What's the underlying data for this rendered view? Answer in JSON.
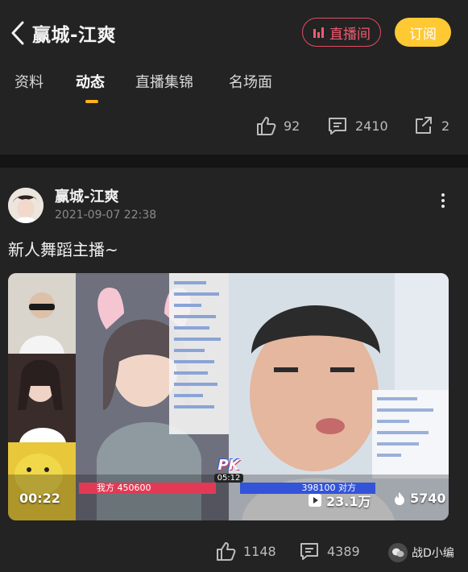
{
  "header": {
    "title": "赢城-江爽",
    "live_button": "直播间",
    "subscribe_button": "订阅"
  },
  "tabs": [
    {
      "label": "资料",
      "active": false
    },
    {
      "label": "动态",
      "active": true
    },
    {
      "label": "直播集锦",
      "active": false
    },
    {
      "label": "名场面",
      "active": false
    }
  ],
  "stats": {
    "likes": "92",
    "comments": "2410",
    "shares": "2"
  },
  "post": {
    "author": "赢城-江爽",
    "timestamp": "2021-09-07 22:38",
    "text": "新人舞蹈主播~",
    "video": {
      "duration": "00:22",
      "views": "23.1万",
      "heat": "5740",
      "pk_logo": "PK",
      "pk_timer": "05:12",
      "pk_left_label": "我方 450600",
      "pk_right_label": "398100 对方"
    },
    "likes": "1148",
    "comments": "4389"
  },
  "watermark": "战D小编",
  "colors": {
    "background": "#232323",
    "accent_live": "#e24b63",
    "accent_subscribe": "#ffc933",
    "tab_underline": "#ffb21a"
  }
}
